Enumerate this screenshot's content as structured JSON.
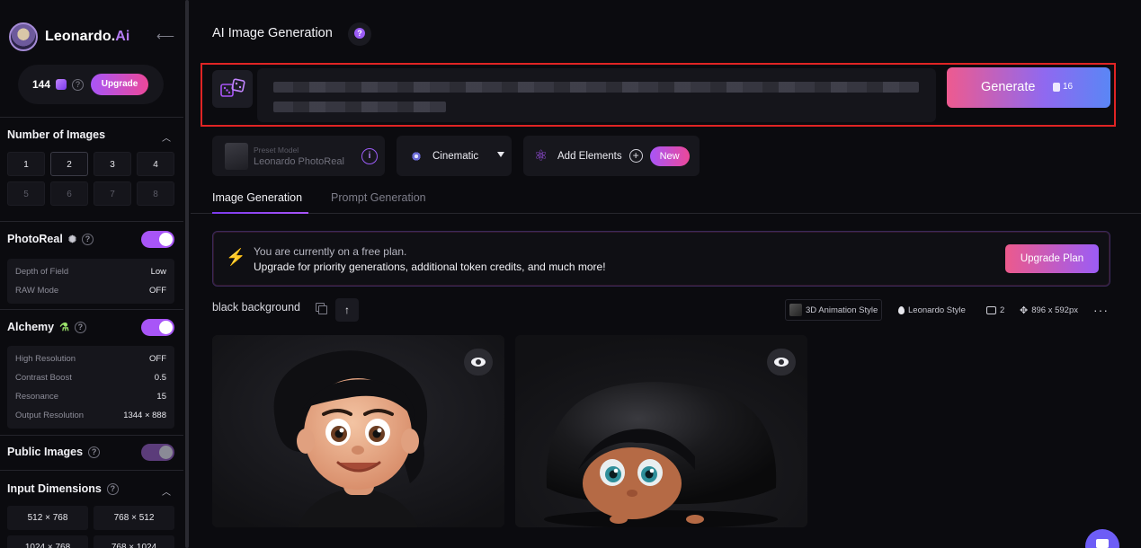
{
  "brand": {
    "name_main": "Leonardo.",
    "name_accent": "Ai"
  },
  "account": {
    "tokens": "144",
    "upgrade_label": "Upgrade"
  },
  "sidebar": {
    "number_of_images": {
      "title": "Number of Images",
      "options": [
        "1",
        "2",
        "3",
        "4",
        "5",
        "6",
        "7",
        "8"
      ],
      "selected": "2"
    },
    "photoreal": {
      "title": "PhotoReal",
      "enabled": true,
      "settings": [
        {
          "key": "Depth of Field",
          "value": "Low"
        },
        {
          "key": "RAW Mode",
          "value": "OFF"
        }
      ]
    },
    "alchemy": {
      "title": "Alchemy",
      "enabled": true,
      "settings": [
        {
          "key": "High Resolution",
          "value": "OFF"
        },
        {
          "key": "Contrast Boost",
          "value": "0.5"
        },
        {
          "key": "Resonance",
          "value": "15"
        },
        {
          "key": "Output Resolution",
          "value": "1344 × 888"
        }
      ]
    },
    "public_images": {
      "title": "Public Images",
      "enabled": false
    },
    "input_dimensions": {
      "title": "Input Dimensions",
      "options": [
        "512 × 768",
        "768 × 512",
        "1024 × 768",
        "768 × 1024"
      ]
    }
  },
  "main": {
    "title": "AI Image Generation",
    "generate": {
      "label": "Generate",
      "cost": "16"
    },
    "model": {
      "caption": "Preset Model",
      "name": "Leonardo PhotoReal"
    },
    "style": {
      "label": "Cinematic"
    },
    "elements": {
      "label": "Add Elements",
      "badge": "New"
    },
    "tabs": [
      {
        "label": "Image Generation",
        "active": true
      },
      {
        "label": "Prompt Generation",
        "active": false
      }
    ],
    "banner": {
      "line1": "You are currently on a free plan.",
      "line2": "Upgrade for priority generations, additional token credits, and much more!",
      "button": "Upgrade Plan"
    },
    "generation": {
      "prompt": "black background",
      "style_tag": "3D Animation Style",
      "model_tag": "Leonardo Style",
      "image_count": "2",
      "dimensions": "896 x 592px"
    }
  },
  "colors": {
    "accent_purple": "#a855f7",
    "accent_pink": "#ec4899",
    "highlight_frame": "#e02424",
    "banner_bolt": "#f5b731"
  }
}
